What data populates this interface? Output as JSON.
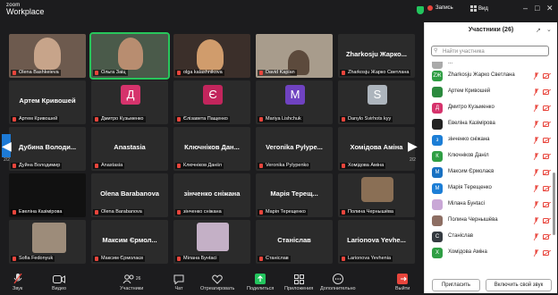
{
  "window": {
    "logo_line1": "zoom",
    "logo_line2": "Workplace",
    "recording": "Запись",
    "view": "Вид"
  },
  "grid": {
    "page_indicator": "2/2",
    "tiles": [
      {
        "label": "Olena Bashkeieva"
      },
      {
        "label": "Ольга Заіц"
      },
      {
        "label": "olga kalashnikova"
      },
      {
        "label": "David Kaplan"
      },
      {
        "label": "Zharkosju Жарко Светлана",
        "name": "Zharkosju Жарко..."
      },
      {
        "label": "Артем Кривошей",
        "name": "Артем Кривошей"
      },
      {
        "label": "Дмитро Кузьменко",
        "avatar": "Д",
        "color": "#d6336c"
      },
      {
        "label": "Єлізавета Пащенко",
        "avatar": "Є",
        "color": "#c2255c"
      },
      {
        "label": "Mariya Lishchuk",
        "avatar": "M",
        "color": "#6f42c1"
      },
      {
        "label": "Danylo Svirhots kyy",
        "avatar": "S",
        "color": "#adb5bd"
      },
      {
        "label": "Дуйна Володимир",
        "name": "Дубина Володи..."
      },
      {
        "label": "Anastasia",
        "name": "Anastasia"
      },
      {
        "label": "Ключніков Данііл",
        "name": "Ключніков Дан..."
      },
      {
        "label": "Veronika Pylypenko",
        "name": "Veronika Pylype..."
      },
      {
        "label": "Хомідова Аміна",
        "name": "Хомідова Аміна"
      },
      {
        "label": "Евеліна Казімірова"
      },
      {
        "label": "Olena Barabanova",
        "name": "Olena Barabanova"
      },
      {
        "label": "зінченко сніжана",
        "name": "зінченко сніжана"
      },
      {
        "label": "Марія Терещенко",
        "name": "Марія Терещ..."
      },
      {
        "label": "Полина Чернышёва"
      },
      {
        "label": "Sofia Fedonyuk"
      },
      {
        "label": "Максим Єрмолаєв",
        "name": "Максим Єрмол..."
      },
      {
        "label": "Мілана Бунtасі"
      },
      {
        "label": "Станіслав",
        "name": "Станіслав"
      },
      {
        "label": "Larionova Yevhenia",
        "name": "Larionova Yevhe..."
      }
    ]
  },
  "toolbar": {
    "audio": "Звук",
    "video": "Видео",
    "participants": "Участники",
    "participants_count": "26",
    "chat": "Чат",
    "react": "Отреагировать",
    "share": "Поделиться",
    "apps": "Приложения",
    "more": "Дополнительно",
    "leave": "Выйти"
  },
  "panel": {
    "title": "Участники (26)",
    "search_placeholder": "Найти участника",
    "partial_top": "...",
    "participants": [
      {
        "initials": "ZЖ",
        "name": "Zharkosju Жарко Светлана",
        "color": "#2f9e44"
      },
      {
        "initials": "",
        "name": "Артем Кривошей",
        "color": "#2b8a3e"
      },
      {
        "initials": "Д",
        "name": "Дмитро Кузьменко",
        "color": "#d6336c"
      },
      {
        "initials": "",
        "name": "Евеліна Казімірова",
        "color": "#222"
      },
      {
        "initials": "з",
        "name": "зінченко сніжана",
        "color": "#1c7ed6"
      },
      {
        "initials": "К",
        "name": "Ключніков Даніл",
        "color": "#2f9e44"
      },
      {
        "initials": "М",
        "name": "Максим Єрмолаєв",
        "color": "#1971c2"
      },
      {
        "initials": "М",
        "name": "Марія Терещенко",
        "color": "#1c7ed6"
      },
      {
        "initials": "",
        "name": "Мілана Бунtасі",
        "color": "#c9a7d6"
      },
      {
        "initials": "",
        "name": "Полина Чернышёва",
        "color": "#8d6e63"
      },
      {
        "initials": "С",
        "name": "Станіслав",
        "color": "#343a40"
      },
      {
        "initials": "Х",
        "name": "Хомідова Аміна",
        "color": "#2f9e44"
      }
    ],
    "invite": "Пригласить",
    "unmute_me": "Включить свой звук"
  }
}
